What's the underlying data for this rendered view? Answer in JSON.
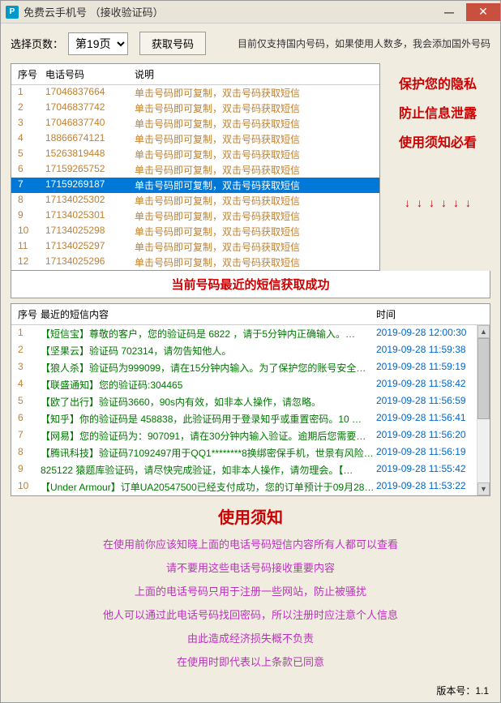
{
  "title": "免费云手机号 （接收验证码）",
  "toolbar": {
    "page_label": "选择页数：",
    "page_value": "第19页",
    "fetch_label": "获取号码",
    "notice": "目前仅支持国内号码，如果使用人数多，我会添加国外号码"
  },
  "phone_table": {
    "headers": {
      "seq": "序号",
      "phone": "电话号码",
      "desc": "说明"
    },
    "rows": [
      {
        "seq": "1",
        "phone": "17046837664",
        "desc": "单击号码即可复制，双击号码获取短信"
      },
      {
        "seq": "2",
        "phone": "17046837742",
        "desc": "单击号码即可复制，双击号码获取短信"
      },
      {
        "seq": "3",
        "phone": "17046837740",
        "desc": "单击号码即可复制，双击号码获取短信"
      },
      {
        "seq": "4",
        "phone": "18866674121",
        "desc": "单击号码即可复制，双击号码获取短信"
      },
      {
        "seq": "5",
        "phone": "15263819448",
        "desc": "单击号码即可复制，双击号码获取短信"
      },
      {
        "seq": "6",
        "phone": "17159265752",
        "desc": "单击号码即可复制，双击号码获取短信"
      },
      {
        "seq": "7",
        "phone": "17159269187",
        "desc": "单击号码即可复制，双击号码获取短信",
        "selected": true
      },
      {
        "seq": "8",
        "phone": "17134025302",
        "desc": "单击号码即可复制，双击号码获取短信"
      },
      {
        "seq": "9",
        "phone": "17134025301",
        "desc": "单击号码即可复制，双击号码获取短信"
      },
      {
        "seq": "10",
        "phone": "17134025298",
        "desc": "单击号码即可复制，双击号码获取短信"
      },
      {
        "seq": "11",
        "phone": "17134025297",
        "desc": "单击号码即可复制，双击号码获取短信"
      },
      {
        "seq": "12",
        "phone": "17134025296",
        "desc": "单击号码即可复制，双击号码获取短信"
      }
    ]
  },
  "side": {
    "line1": "保护您的隐私",
    "line2": "防止信息泄露",
    "line3": "使用须知必看",
    "arrow": "↓"
  },
  "status": "当前号码最近的短信获取成功",
  "sms_table": {
    "headers": {
      "seq": "序号",
      "content": "最近的短信内容",
      "time": "时间"
    },
    "rows": [
      {
        "seq": "1",
        "content": "【短信宝】尊敬的客户，您的验证码是 6822 ，请于5分钟内正确输入。…",
        "time": "2019-09-28 12:00:30"
      },
      {
        "seq": "2",
        "content": "【坚果云】验证码 702314，请勿告知他人。",
        "time": "2019-09-28 11:59:38"
      },
      {
        "seq": "3",
        "content": "【狼人杀】验证码为999099，请在15分钟内输入。为了保护您的账号安全…",
        "time": "2019-09-28 11:59:19"
      },
      {
        "seq": "4",
        "content": "【联盛通知】您的验证码:304465",
        "time": "2019-09-28 11:58:42"
      },
      {
        "seq": "5",
        "content": "【欧了出行】验证码3660，90s内有效，如非本人操作，请忽略。",
        "time": "2019-09-28 11:56:59"
      },
      {
        "seq": "6",
        "content": "【知乎】你的验证码是 458838，此验证码用于登录知乎或重置密码。10 …",
        "time": "2019-09-28 11:56:41"
      },
      {
        "seq": "7",
        "content": "【网易】您的验证码为：907091，请在30分钟内输入验证。逾期后您需要…",
        "time": "2019-09-28 11:56:20"
      },
      {
        "seq": "8",
        "content": "【腾讯科技】验证码71092497用于QQ1********8换绑密保手机，世景有风险…",
        "time": "2019-09-28 11:56:19"
      },
      {
        "seq": "9",
        "content": "825122 猿题库验证码，请尽快完成验证，如非本人操作，请勿理会。【…",
        "time": "2019-09-28 11:55:42"
      },
      {
        "seq": "10",
        "content": "【Under Armour】订单UA20547500已经支付成功，您的订单预计于09月28…",
        "time": "2019-09-28 11:53:22"
      }
    ]
  },
  "instructions": {
    "title": "使用须知",
    "lines": [
      "在使用前你应该知晓上面的电话号码短信内容所有人都可以查看",
      "请不要用这些电话号码接收重要内容",
      "上面的电话号码只用于注册一些网站，防止被骚扰",
      "他人可以通过此电话号码找回密码，所以注册时应注意个人信息",
      "由此造成经济损失概不负责",
      "在使用时即代表以上条款已同意"
    ]
  },
  "footer": {
    "version_label": "版本号：1.1"
  }
}
